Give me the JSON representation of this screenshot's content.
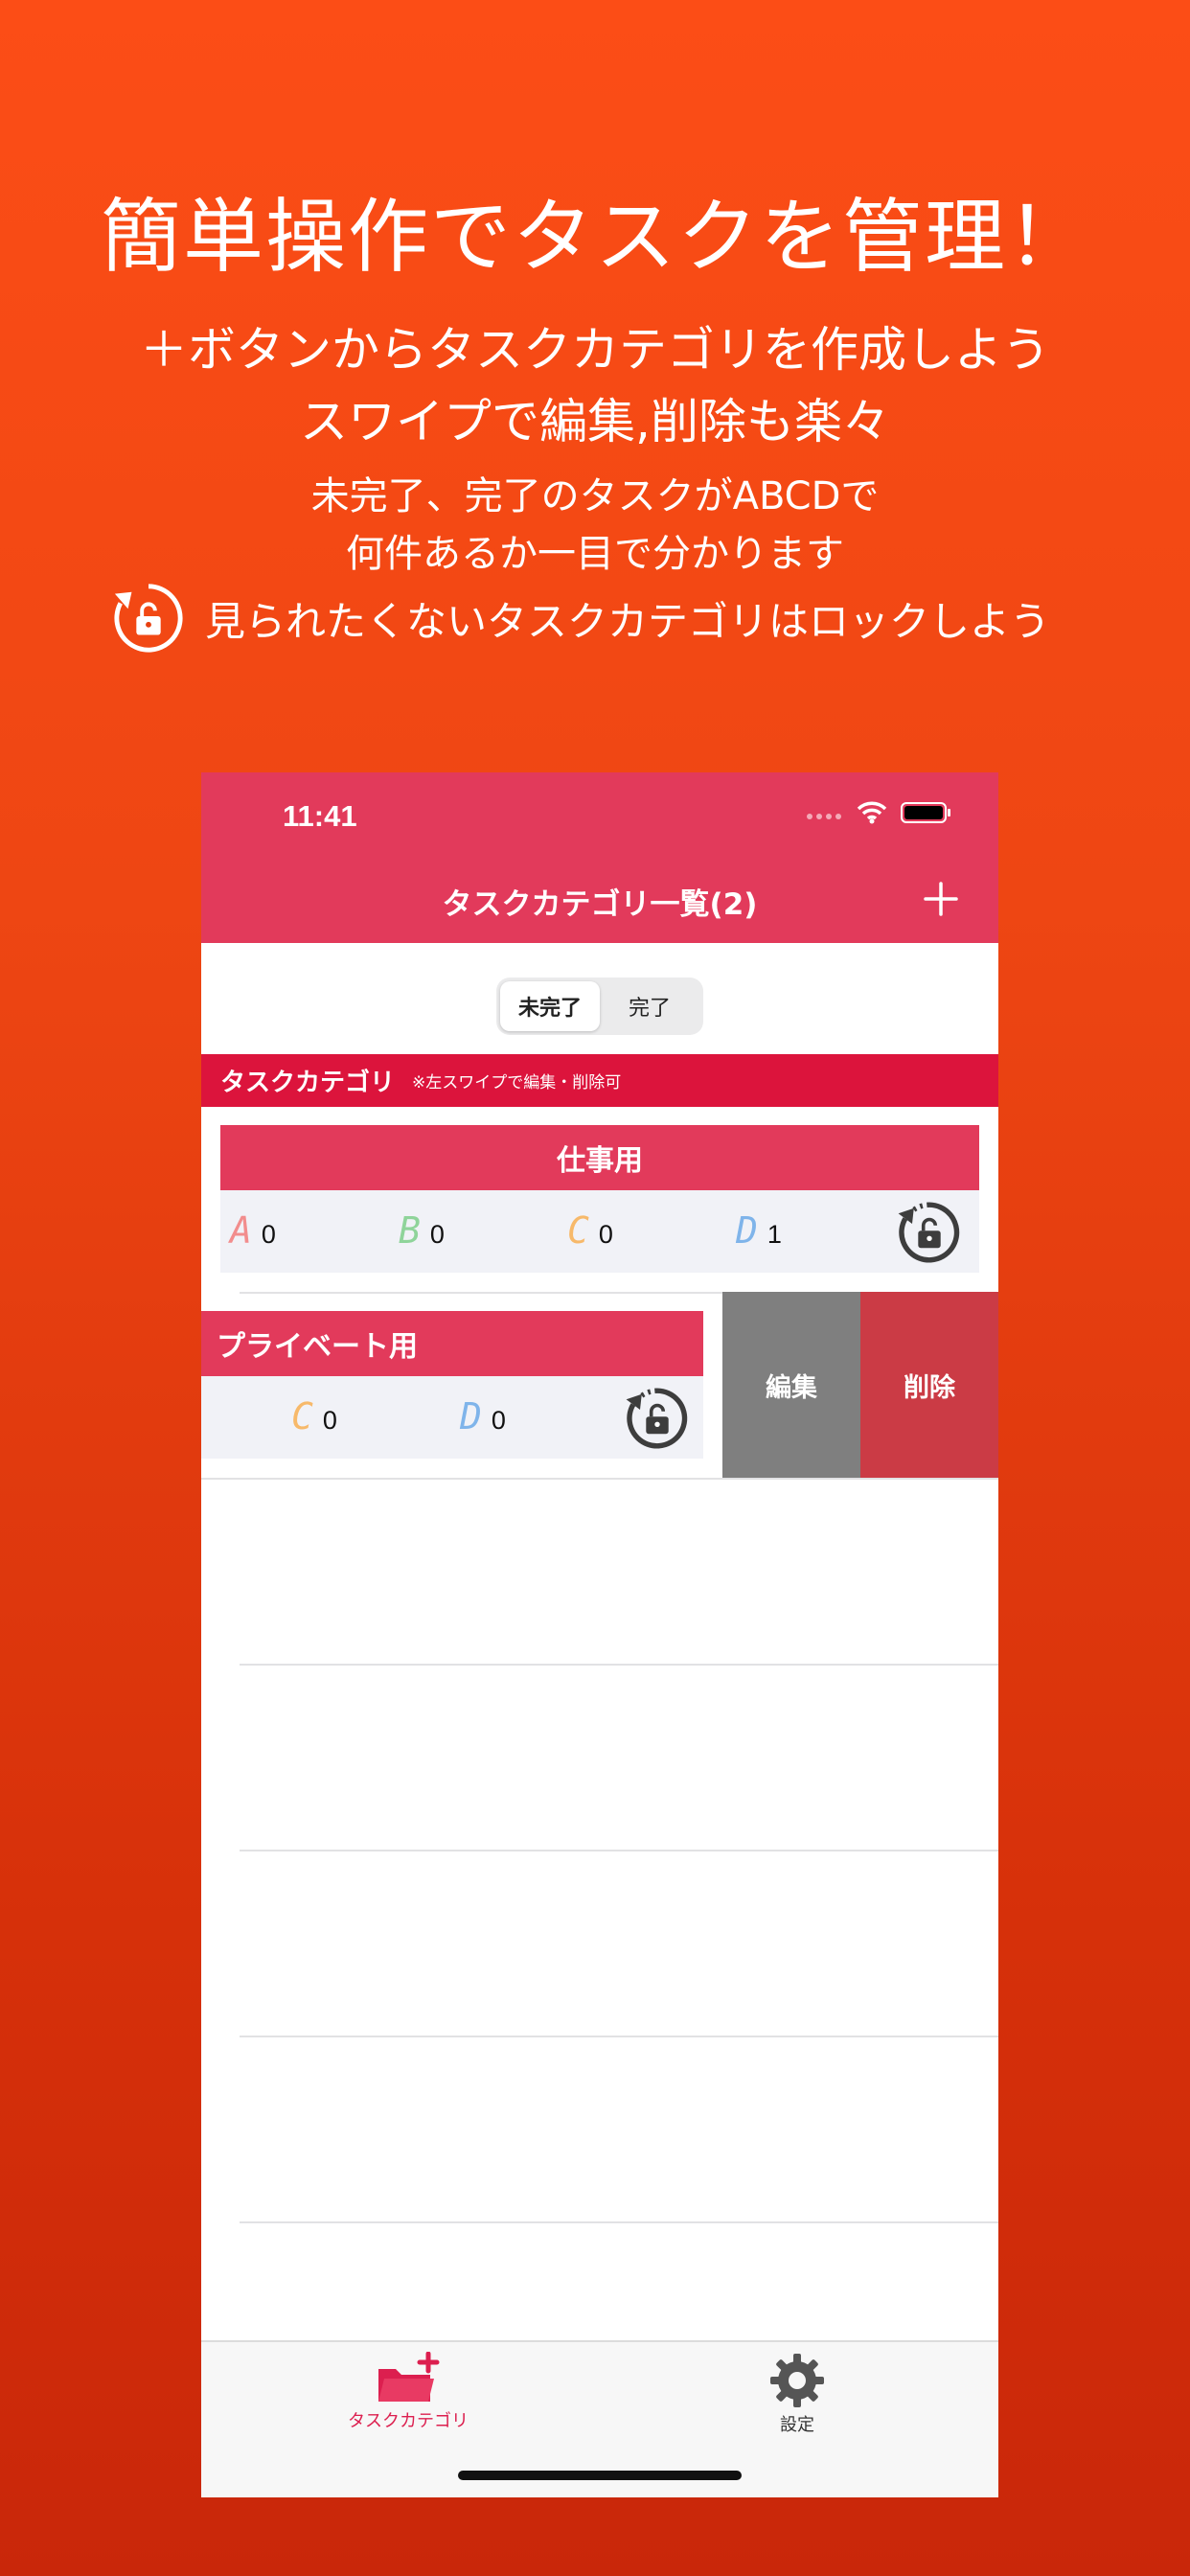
{
  "promo": {
    "title": "簡単操作でタスクを管理！",
    "line1": "＋ボタンからタスクカテゴリを作成しよう",
    "line2": "スワイプで編集,削除も楽々",
    "line3": "未完了、完了のタスクがABCDで",
    "line4": "何件あるか一目で分かります",
    "lock_line": "見られたくないタスクカテゴリはロックしよう"
  },
  "status": {
    "time": "11:41"
  },
  "nav": {
    "title": "タスクカテゴリ一覧(2)"
  },
  "segment": {
    "options": [
      "未完了",
      "完了"
    ],
    "selected": "未完了"
  },
  "section": {
    "title": "タスクカテゴリ",
    "hint": "※左スワイプで編集・削除可"
  },
  "categories": [
    {
      "name": "仕事用",
      "counts": [
        {
          "letter": "A",
          "count": "0",
          "color": "#f28d8d"
        },
        {
          "letter": "B",
          "count": "0",
          "color": "#8fd49a"
        },
        {
          "letter": "C",
          "count": "0",
          "color": "#f7b96a"
        },
        {
          "letter": "D",
          "count": "1",
          "color": "#7fb4ea"
        }
      ]
    },
    {
      "name": "プライベート用",
      "counts": [
        {
          "letter": "C",
          "count": "0",
          "color": "#f7b96a"
        },
        {
          "letter": "D",
          "count": "0",
          "color": "#7fb4ea"
        }
      ]
    }
  ],
  "swipe_actions": {
    "edit": "編集",
    "delete": "削除"
  },
  "tabbar": {
    "tabs": [
      {
        "label": "タスクカテゴリ",
        "icon": "folder-plus-icon",
        "active": true
      },
      {
        "label": "設定",
        "icon": "gear-icon",
        "active": false
      }
    ]
  },
  "colors": {
    "nav": "#e23a5b",
    "section": "#dc143c",
    "accent": "#dc1f4f",
    "edit": "#7f7f7f",
    "delete": "#cb3b45"
  }
}
